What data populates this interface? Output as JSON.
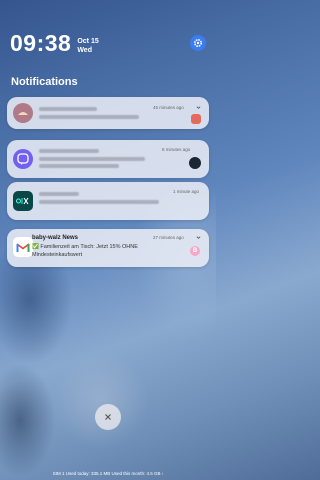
{
  "status": {
    "time": "09:38",
    "date": "Oct 15",
    "day": "Wed"
  },
  "section_title": "Notifications",
  "notifications": [
    {
      "icon": "hands-photo-app-icon",
      "time": "45 minutes ago"
    },
    {
      "icon": "viber-icon",
      "time": "6 minutes ago"
    },
    {
      "icon": "olx-icon",
      "time": "1 minute ago"
    },
    {
      "icon": "gmail-icon",
      "app": "baby-walz News",
      "time": "27 minutes ago",
      "text": "✅ Familienzeit am Tisch: Jetzt 15% OHNE Mindesteinkaufswert",
      "badge_letter": "B"
    }
  ],
  "footer": "SIM 1 Used today: 335.1 MB  Used this month: 4.5 GB",
  "colors": {
    "accent": "#3b7cf0",
    "olx_bg": "#0a4747",
    "viber": "#7360f2"
  }
}
